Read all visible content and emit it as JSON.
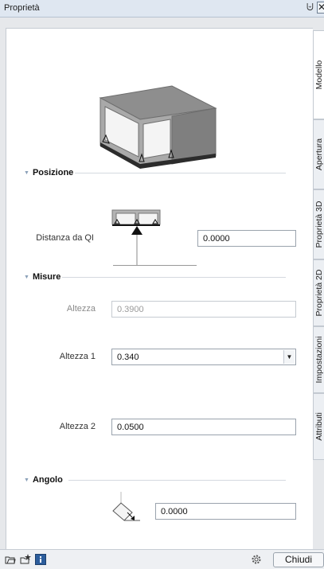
{
  "window": {
    "title": "Proprietà",
    "pin_glyph": "⨄",
    "close_glyph": "✕"
  },
  "tabs": [
    {
      "label": "Modello",
      "active": true
    },
    {
      "label": "Apertura",
      "active": false
    },
    {
      "label": "Proprietà 3D",
      "active": false
    },
    {
      "label": "Proprietà 2D",
      "active": false
    },
    {
      "label": "Impostazioni",
      "active": false
    },
    {
      "label": "Attributi",
      "active": false
    }
  ],
  "sections": {
    "posizione": {
      "title": "Posizione"
    },
    "misure": {
      "title": "Misure"
    },
    "angolo": {
      "title": "Angolo"
    }
  },
  "fields": {
    "distanza": {
      "label": "Distanza da QI",
      "value": "0.0000"
    },
    "altezza": {
      "label": "Altezza",
      "value": "0.3900",
      "disabled": true
    },
    "altezza1": {
      "label": "Altezza 1",
      "value": "0.340"
    },
    "altezza2": {
      "label": "Altezza 2",
      "value": "0.0500"
    },
    "angolo": {
      "value": "0.0000"
    }
  },
  "footer": {
    "close_label": "Chiudi"
  },
  "icons": [
    "folder-open-icon",
    "save-favorite-icon",
    "info-icon",
    "settings-gear-icon",
    "triangle-collapse-icon",
    "chevron-down-icon"
  ],
  "colors": {
    "titlebar": "#dfe7f1",
    "accent": "#1f5fa8",
    "panel_bg": "#e6e8eb"
  }
}
